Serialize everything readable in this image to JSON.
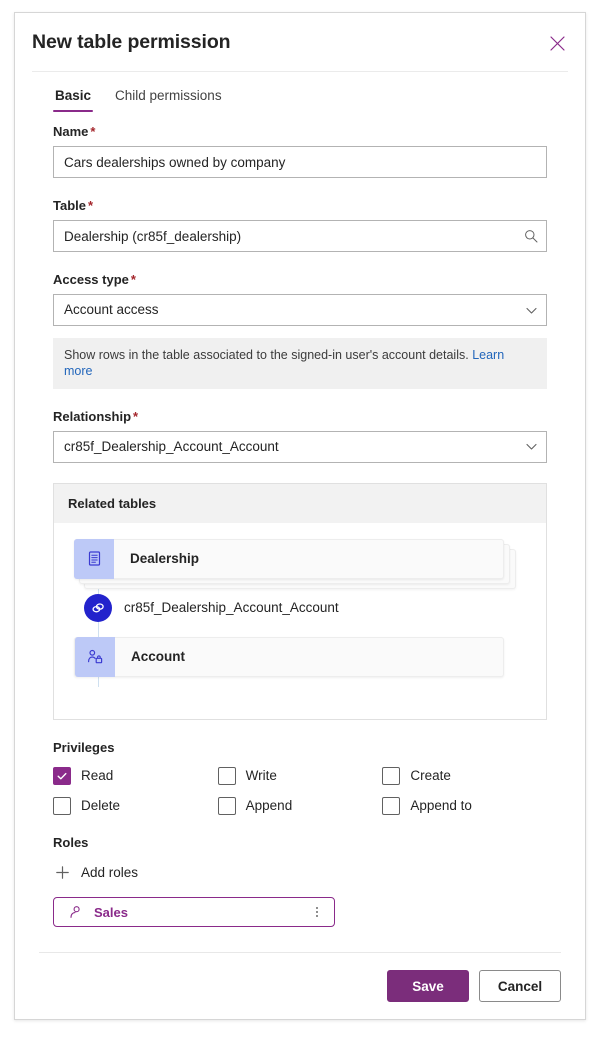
{
  "dialog": {
    "title": "New table permission",
    "close_icon": "close-icon"
  },
  "tabs": [
    {
      "label": "Basic",
      "active": true
    },
    {
      "label": "Child permissions",
      "active": false
    }
  ],
  "fields": {
    "name": {
      "label": "Name",
      "required_marker": "*",
      "value": "Cars dealerships owned by company",
      "placeholder": ""
    },
    "table": {
      "label": "Table",
      "required_marker": "*",
      "value": "Dealership (cr85f_dealership)",
      "placeholder": "",
      "icon": "search-icon"
    },
    "access_type": {
      "label": "Access type",
      "required_marker": "*",
      "value": "Account access",
      "icon": "chevron-down-icon",
      "info_text": "Show rows in the table associated to the signed-in user's account details.",
      "info_link": "Learn more"
    },
    "relationship": {
      "label": "Relationship",
      "required_marker": "*",
      "value": "cr85f_Dealership_Account_Account",
      "icon": "chevron-down-icon"
    }
  },
  "related_tables": {
    "header": "Related tables",
    "source_table": "Dealership",
    "source_icon": "table-icon",
    "relationship_name": "cr85f_Dealership_Account_Account",
    "relationship_icon": "link-icon",
    "target_table": "Account",
    "target_icon": "account-icon"
  },
  "privileges": {
    "label": "Privileges",
    "items": [
      {
        "label": "Read",
        "checked": true
      },
      {
        "label": "Write",
        "checked": false
      },
      {
        "label": "Create",
        "checked": false
      },
      {
        "label": "Delete",
        "checked": false
      },
      {
        "label": "Append",
        "checked": false
      },
      {
        "label": "Append to",
        "checked": false
      }
    ]
  },
  "roles": {
    "label": "Roles",
    "add_label": "Add roles",
    "add_icon": "plus-icon",
    "chips": [
      {
        "label": "Sales",
        "icon": "person-icon",
        "more_icon": "more-vertical-icon"
      }
    ]
  },
  "footer": {
    "save_label": "Save",
    "cancel_label": "Cancel"
  },
  "colors": {
    "accent_purple": "#8a2a8a",
    "save_purple": "#7b2d7b",
    "required_red": "#a4262c",
    "link_blue": "#2266bb",
    "node_tile_blue": "#bdc9f7",
    "relationship_badge_blue": "#2323cc",
    "info_bar_gray": "#f0f0f0",
    "panel_header_gray": "#f2f2f2"
  }
}
